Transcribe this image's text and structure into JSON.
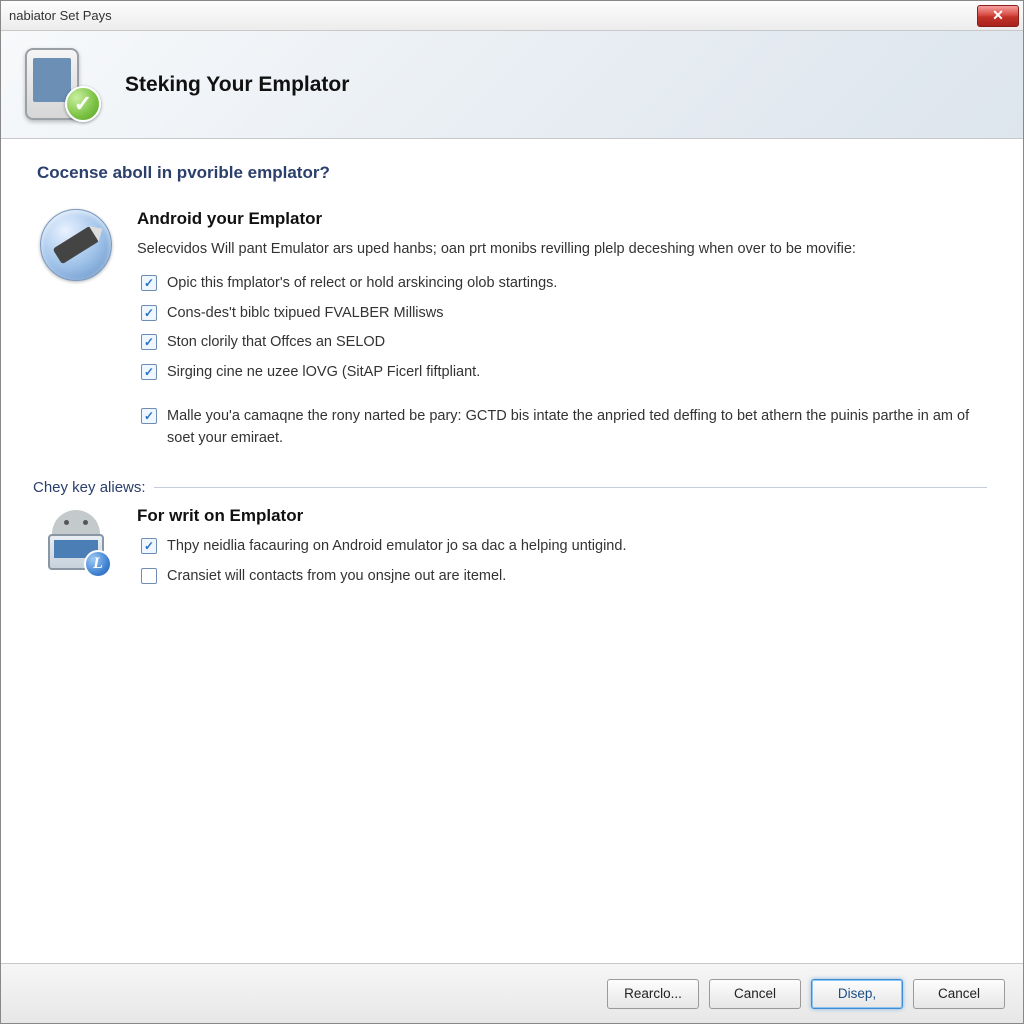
{
  "window": {
    "title": "nabiator Set Pays",
    "close_glyph": "✕"
  },
  "banner": {
    "title": "Steking Your Emplator",
    "check_glyph": "✓"
  },
  "question": "Cocense aboll in pvorible emplator?",
  "section1": {
    "title": "Android your Emplator",
    "description": "Selecvidos Will pant Emulator ars uped hanbs; oan prt monibs revilling plelp deceshing when over to be movifie:",
    "items": [
      {
        "label": "Opic this fmplator's of relect or hold arskincing olob startings.",
        "checked": true
      },
      {
        "label": "Cons-des't biblc txipued FVALBER Millisws",
        "checked": true
      },
      {
        "label": "Ston clorily that Offces an SELOD",
        "checked": true
      },
      {
        "label": "Sirging cine ne uzee lOVG (SitAP Ficerl fiftpliant.",
        "checked": true
      }
    ],
    "extra": {
      "label": "Malle you'a camaqne the rony narted be pary: GCTD bis intate the anpried ted deffing to bet athern the puinis parthe in am of soet your emiraet.",
      "checked": true
    }
  },
  "fieldset_label": "Chey key aliews:",
  "section2": {
    "title": "For writ on Emplator",
    "badge_letter": "L",
    "items": [
      {
        "label": "Thpy neidlia facauring on Android emulator jo sa dac a helping untigind.",
        "checked": true
      },
      {
        "label": "Cransiet will contacts from you onsjne out are itemel.",
        "checked": false
      }
    ]
  },
  "footer": {
    "buttons": [
      {
        "label": "Rearclo...",
        "primary": false
      },
      {
        "label": "Cancel",
        "primary": false
      },
      {
        "label": "Disep,",
        "primary": true
      },
      {
        "label": "Cancel",
        "primary": false
      }
    ]
  }
}
